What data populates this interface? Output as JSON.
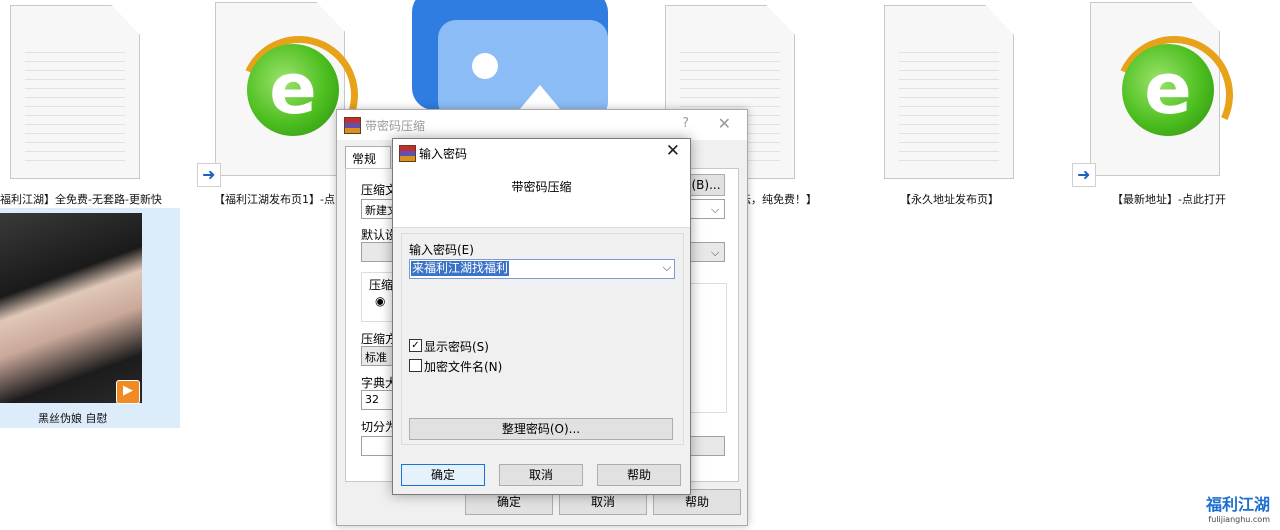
{
  "desktop": {
    "items": [
      {
        "label": "福利江湖】全免费-无套路-更新快"
      },
      {
        "label": "【福利江湖发布页1】-点"
      },
      {
        "label": "坛，纯免费！】"
      },
      {
        "label": "【永久地址发布页】"
      },
      {
        "label": "【最新地址】-点此打开"
      },
      {
        "label": "黑丝伪娘 自慰"
      }
    ],
    "ie_letter": "e",
    "shortcut_arrow": "➜",
    "play_symbol": "▶"
  },
  "outer_dialog": {
    "title": "带密码压缩",
    "help": "?",
    "close": "✕",
    "tab_common": "常规",
    "labels": {
      "archive_name": "压缩文",
      "default": "默认设",
      "format": "压缩",
      "method": "压缩方",
      "dict": "字典大",
      "split": "切分为"
    },
    "values": {
      "archive_name": "新建文",
      "method": "标准",
      "dict": "32"
    },
    "browse_button": "(B)...",
    "ok": "确定",
    "cancel": "取消",
    "help_button": "帮助"
  },
  "inner_dialog": {
    "title": "输入密码",
    "close": "✕",
    "heading": "带密码压缩",
    "password_label": "输入密码(E)",
    "password_value": "来福利江湖找福利",
    "show_password_label": "显示密码(S)",
    "show_password_checked": true,
    "encrypt_names_label": "加密文件名(N)",
    "encrypt_names_checked": false,
    "organize_button": "整理密码(O)...",
    "ok": "确定",
    "cancel": "取消",
    "help": "帮助"
  },
  "watermark": {
    "main": "福利江湖",
    "sub": "fulijianghu.com"
  }
}
